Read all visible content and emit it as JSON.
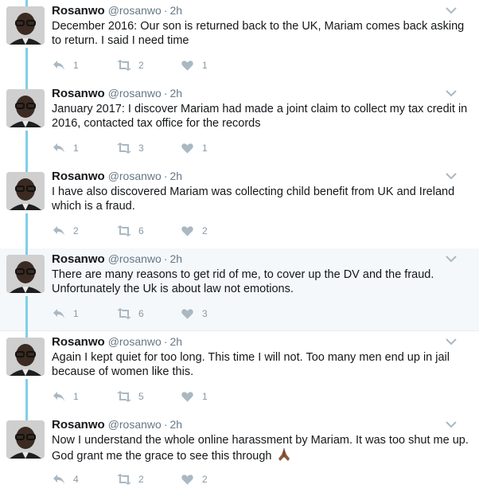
{
  "colors": {
    "thread_line": "#7fcfe6",
    "icon": "#aab8c2",
    "text_muted": "#657786"
  },
  "tweets": [
    {
      "name": "Rosanwo",
      "handle": "@rosanwo",
      "dot": "·",
      "time": "2h",
      "text": "December 2016: Our son is returned back to the UK, Mariam comes back asking to return. I said I need time",
      "replies": "1",
      "retweets": "2",
      "likes": "1"
    },
    {
      "name": "Rosanwo",
      "handle": "@rosanwo",
      "dot": "·",
      "time": "2h",
      "text": "January 2017: I discover Mariam had made a joint claim to collect my tax credit in 2016, contacted tax office for the records",
      "replies": "1",
      "retweets": "3",
      "likes": "1"
    },
    {
      "name": "Rosanwo",
      "handle": "@rosanwo",
      "dot": "·",
      "time": "2h",
      "text": "I have also discovered Mariam was collecting child benefit from UK and Ireland which is a fraud.",
      "replies": "2",
      "retweets": "6",
      "likes": "2"
    },
    {
      "name": "Rosanwo",
      "handle": "@rosanwo",
      "dot": "·",
      "time": "2h",
      "text": "There are many reasons to get rid of me, to cover up the DV and the fraud. Unfortunately the Uk is about law not emotions.",
      "replies": "1",
      "retweets": "6",
      "likes": "3"
    },
    {
      "name": "Rosanwo",
      "handle": "@rosanwo",
      "dot": "·",
      "time": "2h",
      "text": "Again I kept quiet for too long. This time I will not. Too many men end up in jail because of women like this.",
      "replies": "1",
      "retweets": "5",
      "likes": "1"
    },
    {
      "name": "Rosanwo",
      "handle": "@rosanwo",
      "dot": "·",
      "time": "2h",
      "text": "Now I understand the whole online harassment by Mariam. It was too shut me up. God grant me the grace to see this through",
      "emoji": "folded-hands-emoji",
      "replies": "4",
      "retweets": "2",
      "likes": "2"
    }
  ]
}
